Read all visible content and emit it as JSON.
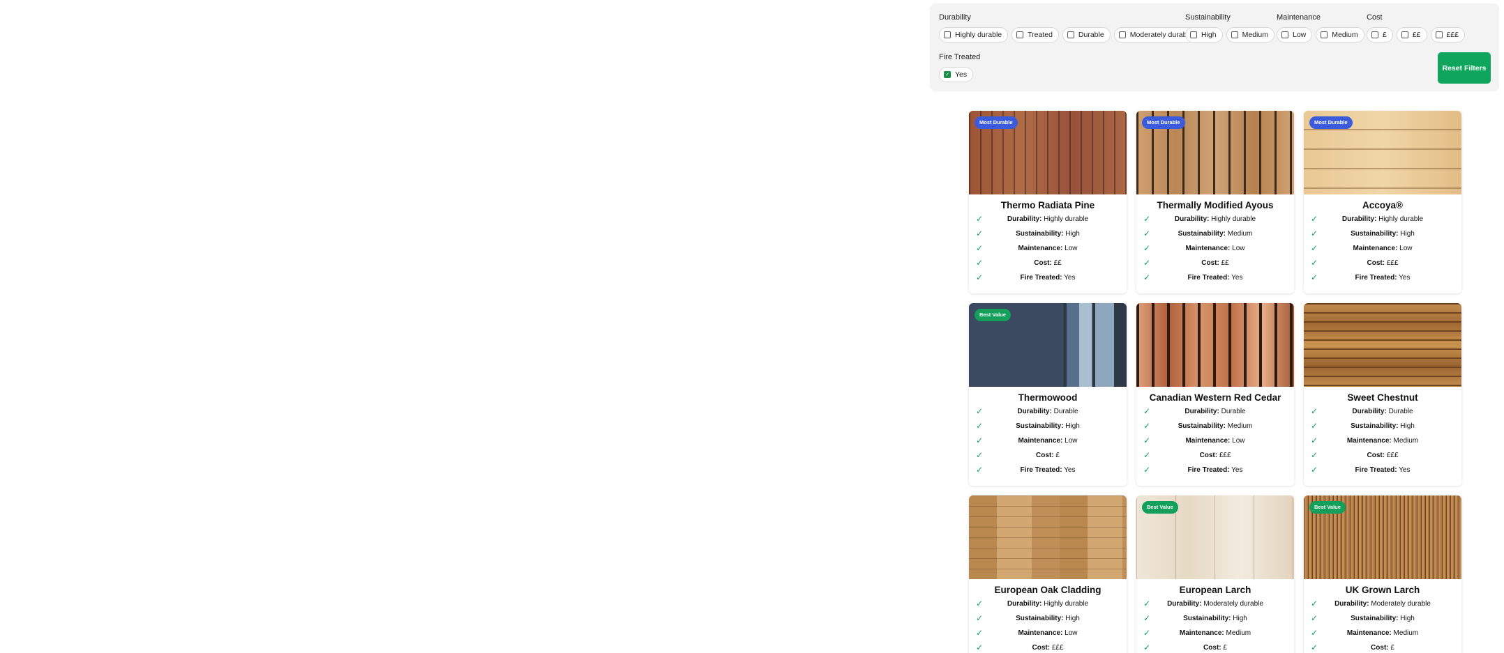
{
  "filters": {
    "durability": {
      "title": "Durability",
      "options": [
        {
          "label": "Highly durable",
          "checked": false
        },
        {
          "label": "Treated",
          "checked": false
        },
        {
          "label": "Durable",
          "checked": false
        },
        {
          "label": "Moderately durable",
          "checked": false
        }
      ]
    },
    "sustainability": {
      "title": "Sustainability",
      "options": [
        {
          "label": "High",
          "checked": false
        },
        {
          "label": "Medium",
          "checked": false
        }
      ]
    },
    "maintenance": {
      "title": "Maintenance",
      "options": [
        {
          "label": "Low",
          "checked": false
        },
        {
          "label": "Medium",
          "checked": false
        }
      ]
    },
    "cost": {
      "title": "Cost",
      "options": [
        {
          "label": "£",
          "checked": false
        },
        {
          "label": "££",
          "checked": false
        },
        {
          "label": "£££",
          "checked": false
        }
      ]
    },
    "fire_treated": {
      "title": "Fire Treated",
      "options": [
        {
          "label": "Yes",
          "checked": true
        }
      ]
    },
    "reset_label": "Reset Filters"
  },
  "labels": {
    "durability": "Durability:",
    "sustainability": "Sustainability:",
    "maintenance": "Maintenance:",
    "cost": "Cost:",
    "fire_treated": "Fire Treated:"
  },
  "colors": {
    "badge_most_durable": "#3b5bdb",
    "badge_best_value": "#12a05a",
    "check": "#12a05a",
    "reset_button": "#0fa55c"
  },
  "products": [
    {
      "name": "Thermo Radiata Pine",
      "badge": "Most Durable",
      "durability": "Highly durable",
      "sustainability": "High",
      "maintenance": "Low",
      "cost": "££",
      "fire_treated": "Yes"
    },
    {
      "name": "Thermally Modified Ayous",
      "badge": "Most Durable",
      "durability": "Highly durable",
      "sustainability": "Medium",
      "maintenance": "Low",
      "cost": "££",
      "fire_treated": "Yes"
    },
    {
      "name": "Accoya®",
      "badge": "Most Durable",
      "durability": "Highly durable",
      "sustainability": "High",
      "maintenance": "Low",
      "cost": "£££",
      "fire_treated": "Yes"
    },
    {
      "name": "Thermowood",
      "badge": "Best Value",
      "durability": "Durable",
      "sustainability": "High",
      "maintenance": "Low",
      "cost": "£",
      "fire_treated": "Yes"
    },
    {
      "name": "Canadian Western Red Cedar",
      "badge": "",
      "durability": "Durable",
      "sustainability": "Medium",
      "maintenance": "Low",
      "cost": "£££",
      "fire_treated": "Yes"
    },
    {
      "name": "Sweet Chestnut",
      "badge": "",
      "durability": "Durable",
      "sustainability": "High",
      "maintenance": "Medium",
      "cost": "£££",
      "fire_treated": "Yes"
    },
    {
      "name": "European Oak Cladding",
      "badge": "",
      "durability": "Highly durable",
      "sustainability": "High",
      "maintenance": "Low",
      "cost": "£££",
      "fire_treated": ""
    },
    {
      "name": "European Larch",
      "badge": "Best Value",
      "durability": "Moderately durable",
      "sustainability": "High",
      "maintenance": "Medium",
      "cost": "£",
      "fire_treated": ""
    },
    {
      "name": "UK Grown Larch",
      "badge": "Best Value",
      "durability": "Moderately durable",
      "sustainability": "High",
      "maintenance": "Medium",
      "cost": "£",
      "fire_treated": ""
    }
  ]
}
